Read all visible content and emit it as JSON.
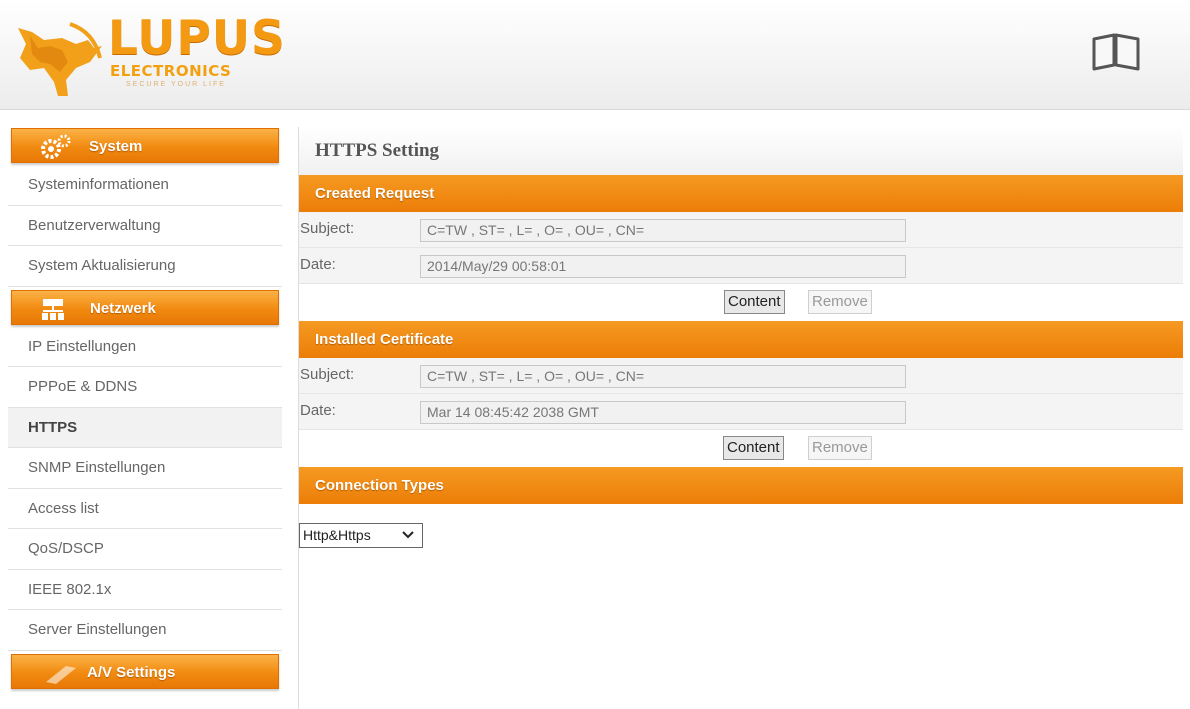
{
  "brand": {
    "name": "LUPUS",
    "sub": "ELECTRONICS",
    "tagline": "SECURE YOUR LIFE"
  },
  "sidebar": {
    "sections": [
      {
        "title": "System",
        "icon": "gear-icon",
        "items": [
          {
            "label": "Systeminformationen",
            "active": false
          },
          {
            "label": "Benutzerverwaltung",
            "active": false
          },
          {
            "label": "System Aktualisierung",
            "active": false
          }
        ]
      },
      {
        "title": "Netzwerk",
        "icon": "network-icon",
        "items": [
          {
            "label": "IP Einstellungen",
            "active": false
          },
          {
            "label": "PPPoE & DDNS",
            "active": false
          },
          {
            "label": "HTTPS",
            "active": true
          },
          {
            "label": "SNMP Einstellungen",
            "active": false
          },
          {
            "label": "Access list",
            "active": false
          },
          {
            "label": "QoS/DSCP",
            "active": false
          },
          {
            "label": "IEEE 802.1x",
            "active": false
          },
          {
            "label": "Server Einstellungen",
            "active": false
          }
        ]
      },
      {
        "title": "A/V Settings",
        "icon": "av-icon",
        "items": []
      }
    ]
  },
  "main": {
    "title": "HTTPS Setting",
    "created_request": {
      "heading": "Created Request",
      "subject_label": "Subject:",
      "subject_value": "C=TW , ST= , L= , O= , OU= , CN=",
      "date_label": "Date:",
      "date_value": "2014/May/29 00:58:01",
      "content_button": "Content",
      "remove_button": "Remove"
    },
    "installed_certificate": {
      "heading": "Installed Certificate",
      "subject_label": "Subject:",
      "subject_value": "C=TW , ST= , L= , O= , OU= , CN=",
      "date_label": "Date:",
      "date_value": "Mar 14 08:45:42 2038 GMT",
      "content_button": "Content",
      "remove_button": "Remove"
    },
    "connection_types": {
      "heading": "Connection Types",
      "selected": "Http&Https"
    }
  },
  "colors": {
    "accent": "#f08a10",
    "accent_light": "#fbb246",
    "active_item_bg": "#f2f2f2"
  }
}
